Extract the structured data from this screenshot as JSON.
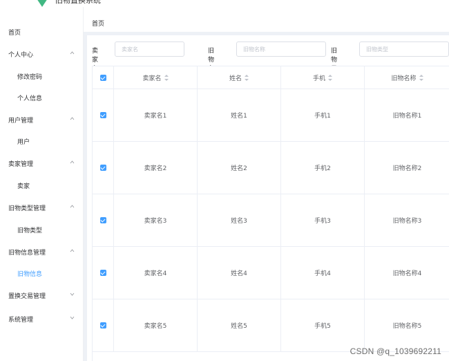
{
  "app": {
    "logo_text": "旧物置换系统"
  },
  "sidebar": {
    "items": [
      {
        "label": "首页",
        "type": "top",
        "chevron": ""
      },
      {
        "label": "个人中心",
        "type": "top",
        "chevron": "up"
      },
      {
        "label": "修改密码",
        "type": "sub",
        "chevron": ""
      },
      {
        "label": "个人信息",
        "type": "sub",
        "chevron": ""
      },
      {
        "label": "用户管理",
        "type": "top",
        "chevron": "up"
      },
      {
        "label": "用户",
        "type": "sub",
        "chevron": ""
      },
      {
        "label": "卖家管理",
        "type": "top",
        "chevron": "up"
      },
      {
        "label": "卖家",
        "type": "sub",
        "chevron": ""
      },
      {
        "label": "旧物类型管理",
        "type": "top",
        "chevron": "up"
      },
      {
        "label": "旧物类型",
        "type": "sub",
        "chevron": ""
      },
      {
        "label": "旧物信息管理",
        "type": "top",
        "chevron": "up"
      },
      {
        "label": "旧物信息",
        "type": "sub",
        "chevron": "",
        "active": true
      },
      {
        "label": "置换交易管理",
        "type": "top",
        "chevron": "down"
      },
      {
        "label": "系统管理",
        "type": "top",
        "chevron": "down"
      }
    ]
  },
  "breadcrumb": {
    "home": "首页"
  },
  "filters": [
    {
      "label": "卖家名",
      "placeholder": "卖家名"
    },
    {
      "label": "旧物名称",
      "placeholder": "旧物名称"
    },
    {
      "label": "旧物类型",
      "placeholder": "旧物类型"
    }
  ],
  "table": {
    "columns": [
      "卖家名",
      "姓名",
      "手机",
      "旧物名称"
    ],
    "rows": [
      [
        "卖家名1",
        "姓名1",
        "手机1",
        "旧物名称1"
      ],
      [
        "卖家名2",
        "姓名2",
        "手机2",
        "旧物名称2"
      ],
      [
        "卖家名3",
        "姓名3",
        "手机3",
        "旧物名称3"
      ],
      [
        "卖家名4",
        "姓名4",
        "手机4",
        "旧物名称4"
      ],
      [
        "卖家名5",
        "姓名5",
        "手机5",
        "旧物名称5"
      ]
    ]
  },
  "watermark": "CSDN @q_1039692211",
  "colors": {
    "accent": "#409eff",
    "logo": "#41b883"
  }
}
